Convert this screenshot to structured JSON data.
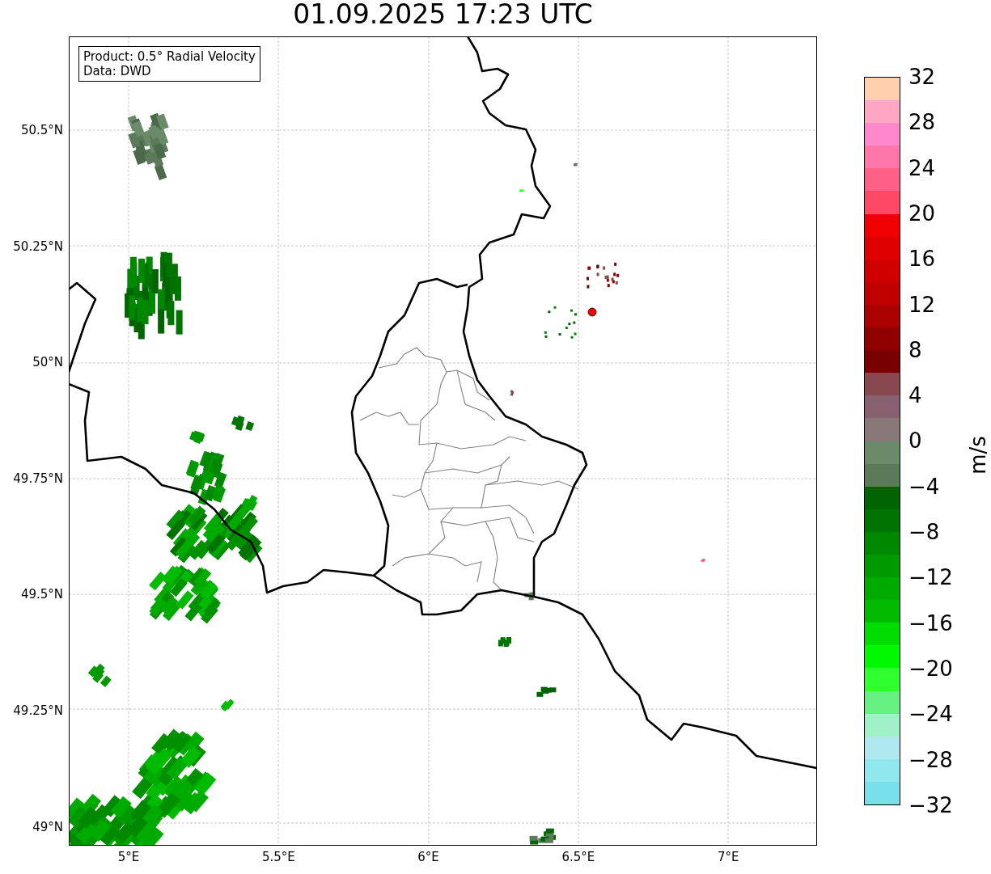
{
  "title": "01.09.2025 17:23 UTC",
  "info_box": {
    "lines": [
      "Product: 0.5° Radial Velocity",
      "Data: DWD"
    ]
  },
  "map": {
    "x_ticks": [
      "5°E",
      "5.5°E",
      "6°E",
      "6.5°E",
      "7°E"
    ],
    "y_ticks": [
      "50.5°N",
      "50.25°N",
      "50°N",
      "49.75°N",
      "49.5°N",
      "49.25°N",
      "49°N"
    ]
  },
  "colorbar": {
    "label": "m/s",
    "ticks": [
      "32",
      "28",
      "24",
      "20",
      "16",
      "12",
      "8",
      "4",
      "0",
      "−4",
      "−8",
      "−12",
      "−16",
      "−20",
      "−24",
      "−28",
      "−32"
    ],
    "segments": [
      {
        "color": "#ffcfae"
      },
      {
        "color": "#ffa7c4"
      },
      {
        "color": "#ff88cc"
      },
      {
        "color": "#ff77a8"
      },
      {
        "color": "#ff6088"
      },
      {
        "color": "#ff4866"
      },
      {
        "color": "#f00000"
      },
      {
        "color": "#e00000"
      },
      {
        "color": "#d00000"
      },
      {
        "color": "#c00000"
      },
      {
        "color": "#aa0000"
      },
      {
        "color": "#900000"
      },
      {
        "color": "#780000"
      },
      {
        "color": "#884850"
      },
      {
        "color": "#886070"
      },
      {
        "color": "#887878"
      },
      {
        "color": "#6a8a6a"
      },
      {
        "color": "#5a7a5a"
      },
      {
        "color": "#006400"
      },
      {
        "color": "#007400"
      },
      {
        "color": "#008800"
      },
      {
        "color": "#009a00"
      },
      {
        "color": "#00ab00"
      },
      {
        "color": "#00bb00"
      },
      {
        "color": "#00dd00"
      },
      {
        "color": "#00f800"
      },
      {
        "color": "#30ff30"
      },
      {
        "color": "#66f080"
      },
      {
        "color": "#a0f0c8"
      },
      {
        "color": "#b0e8f0"
      },
      {
        "color": "#90e8ee"
      },
      {
        "color": "#78e0e8"
      }
    ]
  }
}
